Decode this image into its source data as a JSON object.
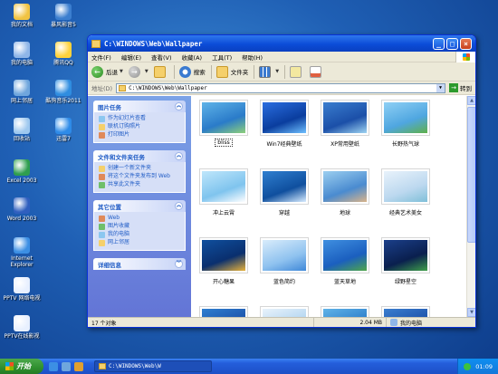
{
  "desktop": {
    "icons": [
      {
        "label": "我的文档",
        "name": "my-documents-icon",
        "color": "#f1c342"
      },
      {
        "label": "暴风影音5",
        "name": "storm-player-icon",
        "color": "#3b7ecf"
      },
      {
        "label": "我的电脑",
        "name": "my-computer-icon",
        "color": "#8fb6e8"
      },
      {
        "label": "腾讯QQ",
        "name": "qq-icon",
        "color": "#ffd23b"
      },
      {
        "label": "网上邻居",
        "name": "network-places-icon",
        "color": "#6fa6dd"
      },
      {
        "label": "酷狗音乐2011",
        "name": "kugou-icon",
        "color": "#2f8de0"
      },
      {
        "label": "回收站",
        "name": "recycle-bin-icon",
        "color": "#9ec8ef"
      },
      {
        "label": "迅雷7",
        "name": "xunlei-icon",
        "color": "#2e8be8"
      },
      {
        "label": "Excel 2003",
        "name": "excel-icon",
        "color": "#2f9e4f"
      },
      {
        "label": "Word 2003",
        "name": "word-icon",
        "color": "#2f5fbf"
      },
      {
        "label": "Internet Explorer",
        "name": "ie-icon",
        "color": "#3c8fe4"
      },
      {
        "label": "PPTV 网络电视",
        "name": "pptv-icon",
        "color": "#e8f0ff"
      },
      {
        "label": "PPTV在线影视",
        "name": "pptv-online-icon",
        "color": "#e8f0ff"
      }
    ]
  },
  "window": {
    "title": "C:\\WINDOWS\\Web\\Wallpaper",
    "menus": [
      "文件(F)",
      "编辑(E)",
      "查看(V)",
      "收藏(A)",
      "工具(T)",
      "帮助(H)"
    ],
    "toolbar": {
      "back": "后退",
      "search": "搜索",
      "folders": "文件夹"
    },
    "address": {
      "label": "地址(D)",
      "value": "C:\\WINDOWS\\Web\\Wallpaper",
      "go": "转到"
    },
    "panels": [
      {
        "title": "图片任务",
        "items": [
          "作为幻灯片查看",
          "联机订购照片",
          "打印图片"
        ]
      },
      {
        "title": "文件和文件夹任务",
        "items": [
          "创建一个新文件夹",
          "将这个文件夹发布到 Web",
          "共享此文件夹"
        ]
      },
      {
        "title": "其它位置",
        "items": [
          "Web",
          "图片收藏",
          "我的电脑",
          "网上邻居"
        ]
      },
      {
        "title": "详细信息",
        "items": []
      }
    ],
    "files": [
      {
        "name": "bliss",
        "c1": "#5fb3e8",
        "c2": "#2a7bc9",
        "c3": "#8ed07a"
      },
      {
        "name": "Win7经典壁纸",
        "c1": "#2b6ee0",
        "c2": "#0a3d9e",
        "c3": "#6fc0ff"
      },
      {
        "name": "XP常用壁纸",
        "c1": "#3b7ecf",
        "c2": "#1b4fa8",
        "c3": "#9fd4f2"
      },
      {
        "name": "长野热气球",
        "c1": "#8fd0f5",
        "c2": "#4fa6e0",
        "c3": "#5fb04a"
      },
      {
        "name": "冲上云霄",
        "c1": "#bfe6fb",
        "c2": "#7fc4ee",
        "c3": "#ffffff"
      },
      {
        "name": "穿越",
        "c1": "#2f7fd0",
        "c2": "#0f4f9e",
        "c3": "#d8ecff"
      },
      {
        "name": "地球",
        "c1": "#9ccff0",
        "c2": "#4a8bd0",
        "c3": "#d9b48a"
      },
      {
        "name": "经典艺术美女",
        "c1": "#e8f2fb",
        "c2": "#bcd8ef",
        "c3": "#7fbfd8"
      },
      {
        "name": "开心糖果",
        "c1": "#0f4f9e",
        "c2": "#0a2f6e",
        "c3": "#e8b23a"
      },
      {
        "name": "蓝色简约",
        "c1": "#d9ecfb",
        "c2": "#8fc2ef",
        "c3": "#3f88d8"
      },
      {
        "name": "蓝天草地",
        "c1": "#3f8fe0",
        "c2": "#1b5fbf",
        "c3": "#4fa64a"
      },
      {
        "name": "绿野星空",
        "c1": "#1b3f8a",
        "c2": "#0a1f4e",
        "c3": "#3f9f4a"
      },
      {
        "name": "",
        "c1": "#2f7fd0",
        "c2": "#1b4fa8",
        "c3": "#7fc4ee"
      },
      {
        "name": "",
        "c1": "#e8f2fb",
        "c2": "#b0d4f0",
        "c3": "#5f9fd8"
      },
      {
        "name": "",
        "c1": "#5fb3e8",
        "c2": "#2a7bc9",
        "c3": "#bfe6fb"
      },
      {
        "name": "",
        "c1": "#3b7ecf",
        "c2": "#1b4fa8",
        "c3": "#8ed07a"
      }
    ],
    "status": {
      "count": "17 个对象",
      "size": "2.04 MB",
      "location": "我的电脑"
    }
  },
  "taskbar": {
    "start": "开始",
    "task": "C:\\WINDOWS\\Web\\W",
    "clock": "01:09"
  }
}
